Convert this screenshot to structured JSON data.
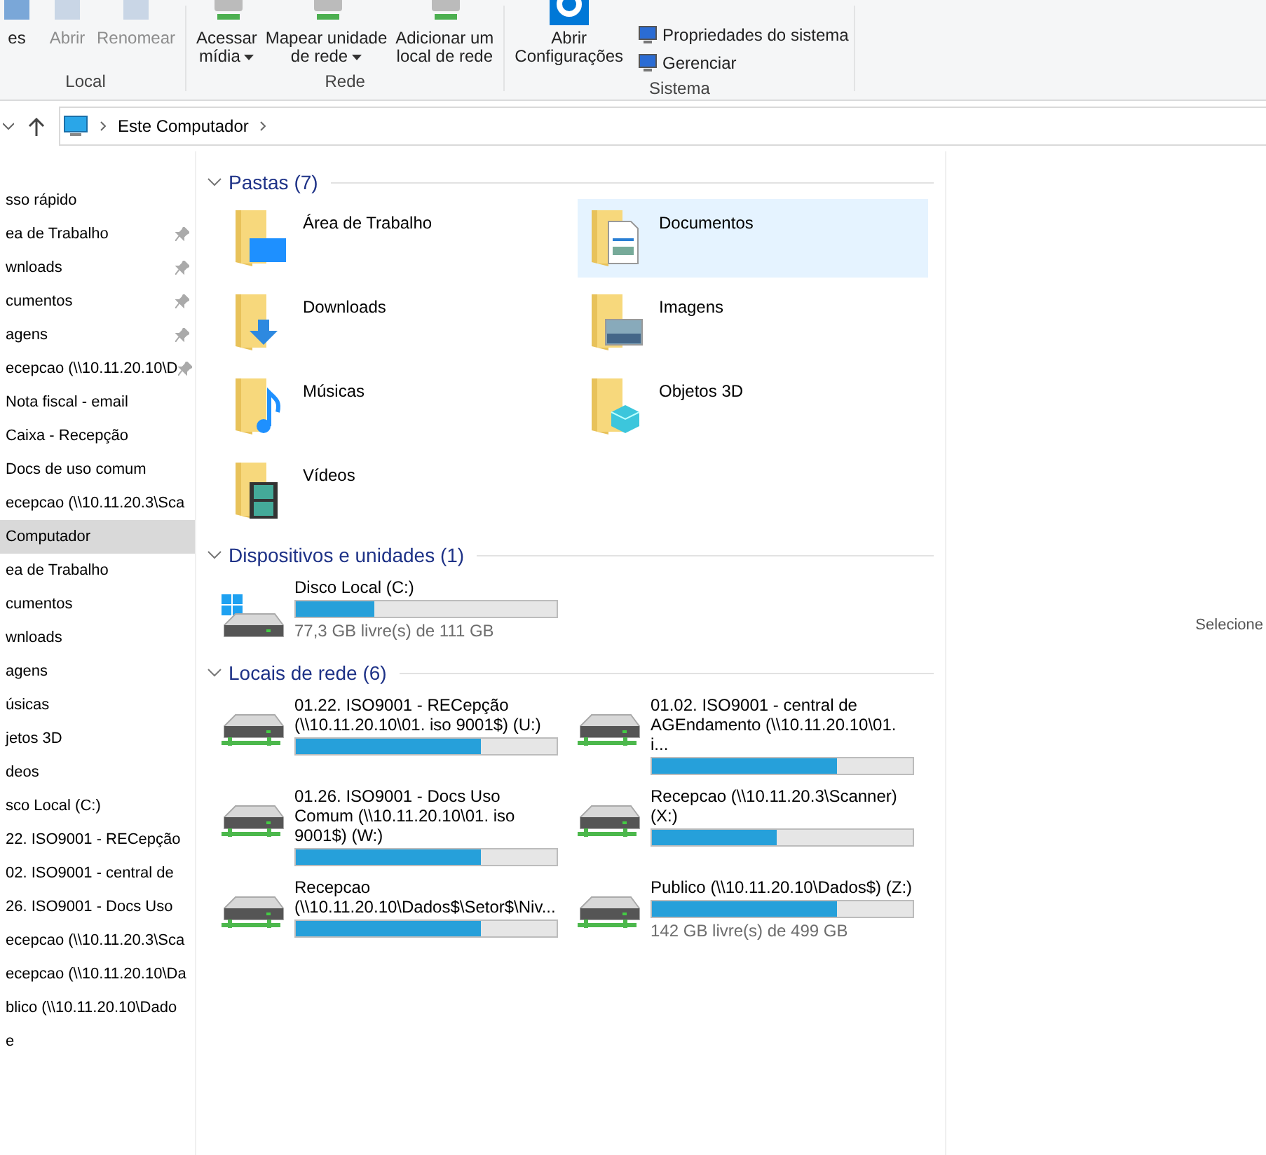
{
  "ribbon": {
    "groups": [
      {
        "label": "Local",
        "buttons": [
          {
            "lines": [
              "es"
            ],
            "disabled": false,
            "dropdown": false
          },
          {
            "lines": [
              "Abrir"
            ],
            "disabled": true,
            "dropdown": false
          },
          {
            "lines": [
              "Renomear"
            ],
            "disabled": true,
            "dropdown": false
          }
        ]
      },
      {
        "label": "Rede",
        "buttons": [
          {
            "lines": [
              "Acessar",
              "mídia"
            ],
            "disabled": false,
            "dropdown": true
          },
          {
            "lines": [
              "Mapear unidade",
              "de rede"
            ],
            "disabled": false,
            "dropdown": true
          },
          {
            "lines": [
              "Adicionar um",
              "local de rede"
            ],
            "disabled": false,
            "dropdown": false
          }
        ]
      },
      {
        "label": "Sistema",
        "buttons": [
          {
            "lines": [
              "Abrir",
              "Configurações"
            ],
            "disabled": false,
            "dropdown": false
          }
        ],
        "small": [
          "Propriedades do sistema",
          "Gerenciar"
        ]
      }
    ]
  },
  "address": {
    "path": [
      "Este Computador"
    ]
  },
  "nav": [
    {
      "label": "sso rápido",
      "pinned": false,
      "selected": false
    },
    {
      "label": "ea de Trabalho",
      "pinned": true,
      "selected": false
    },
    {
      "label": "wnloads",
      "pinned": true,
      "selected": false
    },
    {
      "label": "cumentos",
      "pinned": true,
      "selected": false
    },
    {
      "label": "agens",
      "pinned": true,
      "selected": false
    },
    {
      "label": "ecepcao (\\\\10.11.20.10\\D",
      "pinned": true,
      "selected": false
    },
    {
      "label": "Nota fiscal - email",
      "pinned": false,
      "selected": false
    },
    {
      "label": "Caixa - Recepção",
      "pinned": false,
      "selected": false
    },
    {
      "label": "Docs de uso comum",
      "pinned": false,
      "selected": false
    },
    {
      "label": "ecepcao (\\\\10.11.20.3\\Sca",
      "pinned": false,
      "selected": false
    },
    {
      "label": "Computador",
      "pinned": false,
      "selected": true
    },
    {
      "label": "ea de Trabalho",
      "pinned": false,
      "selected": false
    },
    {
      "label": "cumentos",
      "pinned": false,
      "selected": false
    },
    {
      "label": "wnloads",
      "pinned": false,
      "selected": false
    },
    {
      "label": "agens",
      "pinned": false,
      "selected": false
    },
    {
      "label": "úsicas",
      "pinned": false,
      "selected": false
    },
    {
      "label": "jetos 3D",
      "pinned": false,
      "selected": false
    },
    {
      "label": "deos",
      "pinned": false,
      "selected": false
    },
    {
      "label": "sco Local (C:)",
      "pinned": false,
      "selected": false
    },
    {
      "label": "22. ISO9001 - RECepção",
      "pinned": false,
      "selected": false
    },
    {
      "label": "02. ISO9001 - central de",
      "pinned": false,
      "selected": false
    },
    {
      "label": "26. ISO9001 - Docs Uso",
      "pinned": false,
      "selected": false
    },
    {
      "label": "ecepcao (\\\\10.11.20.3\\Sca",
      "pinned": false,
      "selected": false
    },
    {
      "label": "ecepcao (\\\\10.11.20.10\\Da",
      "pinned": false,
      "selected": false
    },
    {
      "label": "blico (\\\\10.11.20.10\\Dado",
      "pinned": false,
      "selected": false
    },
    {
      "label": "e",
      "pinned": false,
      "selected": false
    }
  ],
  "folders": {
    "title": "Pastas (7)",
    "items": [
      {
        "name": "Área de Trabalho",
        "selected": false
      },
      {
        "name": "Documentos",
        "selected": true
      },
      {
        "name": "Downloads",
        "selected": false
      },
      {
        "name": "Imagens",
        "selected": false
      },
      {
        "name": "Músicas",
        "selected": false
      },
      {
        "name": "Objetos 3D",
        "selected": false
      },
      {
        "name": "Vídeos",
        "selected": false
      }
    ]
  },
  "devices": {
    "title": "Dispositivos e unidades (1)",
    "items": [
      {
        "name": "Disco Local (C:)",
        "level": 0.3,
        "free": "77,3 GB livre(s) de 111 GB"
      }
    ]
  },
  "network": {
    "title": "Locais de rede (6)",
    "items": [
      {
        "name": "01.22. ISO9001 - RECepção (\\\\10.11.20.10\\01. iso 9001$) (U:)",
        "level": 0.71
      },
      {
        "name": "01.02. ISO9001 - central de AGEndamento (\\\\10.11.20.10\\01. i...",
        "level": 0.71
      },
      {
        "name": "01.26. ISO9001 - Docs Uso Comum (\\\\10.11.20.10\\01. iso 9001$) (W:)",
        "level": 0.71
      },
      {
        "name": "Recepcao (\\\\10.11.20.3\\Scanner) (X:)",
        "level": 0.48
      },
      {
        "name": "Recepcao (\\\\10.11.20.10\\Dados$\\Setor$\\Niv...",
        "level": 0.71
      },
      {
        "name": "Publico (\\\\10.11.20.10\\Dados$) (Z:)",
        "level": 0.71,
        "free": "142 GB livre(s) de 499 GB"
      }
    ]
  },
  "details": {
    "hint": "Selecione"
  }
}
